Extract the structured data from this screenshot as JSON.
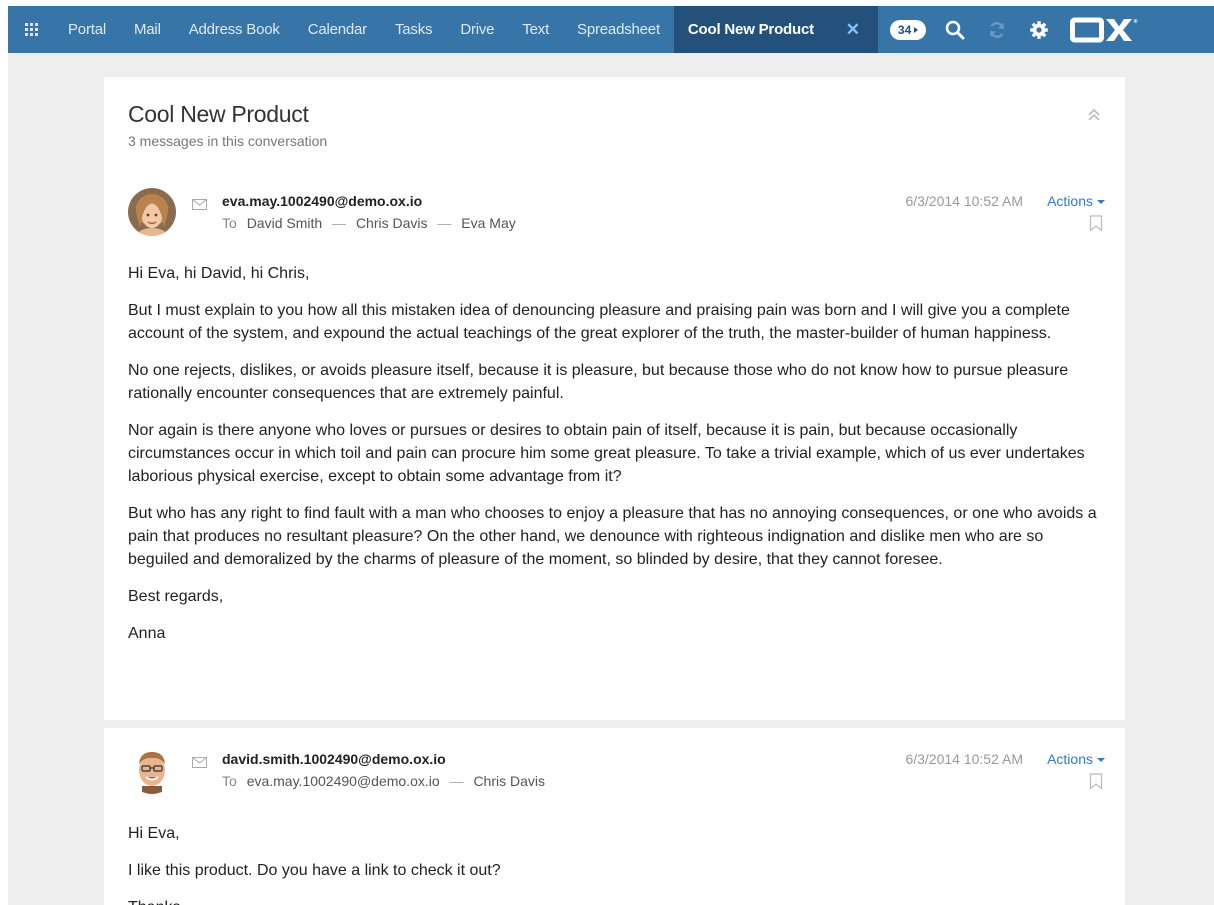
{
  "topbar": {
    "nav": [
      "Portal",
      "Mail",
      "Address Book",
      "Calendar",
      "Tasks",
      "Drive",
      "Text",
      "Spreadsheet"
    ],
    "active_tab": "Cool New Product",
    "badge_count": "34",
    "logo": "OX"
  },
  "conversation": {
    "title": "Cool New Product",
    "subtitle": "3 messages in this conversation"
  },
  "messages": [
    {
      "from": "eva.may.1002490@demo.ox.io",
      "to_label": "To",
      "to": [
        "David Smith",
        "Chris Davis",
        "Eva May"
      ],
      "date": "6/3/2014 10:52 AM",
      "actions": "Actions",
      "body": [
        "Hi Eva, hi David, hi Chris,",
        "But I must explain to you how all this mistaken idea of denouncing pleasure and praising pain was born and I will give you a complete account of the system, and expound the actual teachings of the great explorer of the truth, the master-builder of human happiness.",
        "No one rejects, dislikes, or avoids pleasure itself, because it is pleasure, but because those who do not know how to pursue pleasure rationally encounter consequences that are extremely painful.",
        "Nor again is there anyone who loves or pursues or desires to obtain pain of itself, because it is pain, but because occasionally circumstances occur in which toil and pain can procure him some great pleasure. To take a trivial example, which of us ever undertakes laborious physical exercise, except to obtain some advantage from it?",
        "But who has any right to find fault with a man who chooses to enjoy a pleasure that has no annoying consequences, or one who avoids a pain that produces no resultant pleasure? On the other hand, we denounce with righteous indignation and dislike men who are so beguiled and demoralized by the charms of pleasure of the moment, so blinded by desire, that they cannot foresee.",
        "Best regards,",
        "Anna"
      ]
    },
    {
      "from": "david.smith.1002490@demo.ox.io",
      "to_label": "To",
      "to": [
        "eva.may.1002490@demo.ox.io",
        "Chris Davis"
      ],
      "date": "6/3/2014 10:52 AM",
      "actions": "Actions",
      "body": [
        "Hi Eva,",
        "I like this product. Do you have a link to check it out?",
        "Thanks"
      ]
    }
  ],
  "colors": {
    "topbar": "#3774a8",
    "topbar_active": "#24507c",
    "link": "#2f7ad0",
    "page_bg": "#eeeeee"
  }
}
